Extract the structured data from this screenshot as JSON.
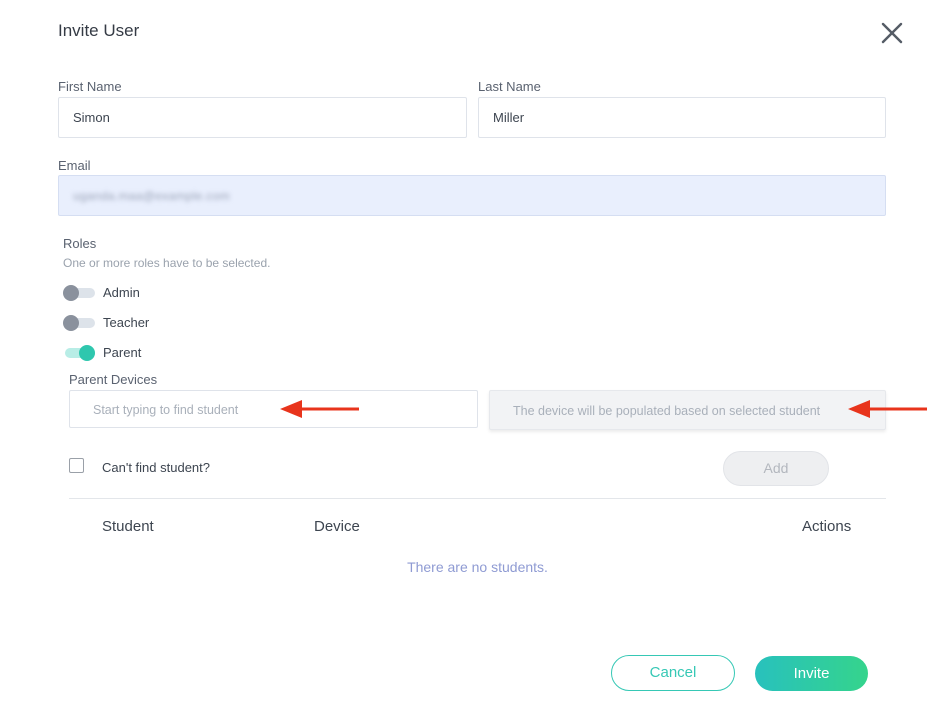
{
  "dialog": {
    "title": "Invite User"
  },
  "form": {
    "first_name": {
      "label": "First Name",
      "value": "Simon"
    },
    "last_name": {
      "label": "Last Name",
      "value": "Miller"
    },
    "email": {
      "label": "Email",
      "value": "uganda.maa@example.com"
    }
  },
  "roles": {
    "label": "Roles",
    "hint": "One or more roles have to be selected.",
    "items": [
      {
        "label": "Admin",
        "enabled": false
      },
      {
        "label": "Teacher",
        "enabled": false
      },
      {
        "label": "Parent",
        "enabled": true
      }
    ]
  },
  "parent_devices": {
    "label": "Parent Devices",
    "student_placeholder": "Start typing to find student",
    "device_placeholder": "The device will be populated based on selected student",
    "cant_find_label": "Can't find student?",
    "add_label": "Add"
  },
  "table": {
    "columns": [
      "Student",
      "Device",
      "Actions"
    ],
    "empty_text": "There are no students."
  },
  "footer": {
    "cancel_label": "Cancel",
    "invite_label": "Invite"
  },
  "colors": {
    "accent": "#2fc7ae",
    "annotation_arrow": "#e8341c",
    "empty_text": "#8f9bd3"
  }
}
